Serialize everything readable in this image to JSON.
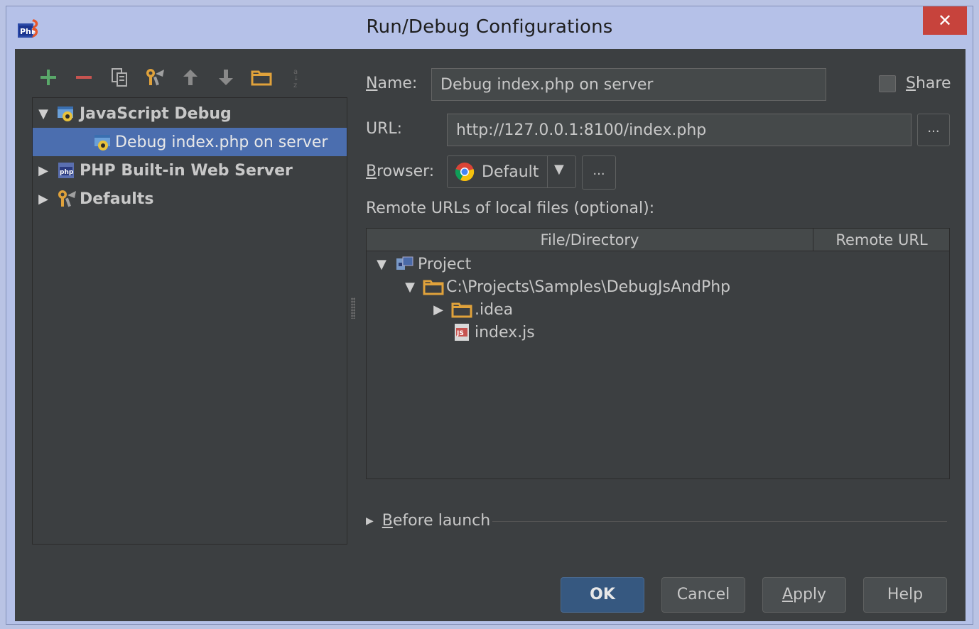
{
  "window": {
    "title": "Run/Debug Configurations",
    "close_label": "✕"
  },
  "tree": {
    "items": [
      {
        "label": "JavaScript Debug",
        "expanded": true
      },
      {
        "label": "Debug index.php on server",
        "selected": true
      },
      {
        "label": "PHP Built-in Web Server",
        "expanded": false
      },
      {
        "label": "Defaults",
        "expanded": false
      }
    ]
  },
  "form": {
    "name_label_u": "N",
    "name_label_rest": "ame:",
    "name_value": "Debug index.php on server",
    "share_label_u": "S",
    "share_label_rest": "hare",
    "url_label": "URL:",
    "url_value": "http://127.0.0.1:8100/index.php",
    "ellipsis": "...",
    "browser_label_u": "B",
    "browser_label_rest": "rowser:",
    "browser_value": "Default",
    "remote_label": "Remote URLs of local files (optional):"
  },
  "mapping_table": {
    "columns": [
      "File/Directory",
      "Remote URL"
    ],
    "rows": [
      {
        "label": "Project"
      },
      {
        "label": "C:\\Projects\\Samples\\DebugJsAndPhp"
      },
      {
        "label": ".idea"
      },
      {
        "label": "index.js"
      }
    ]
  },
  "before_launch": {
    "label_u": "B",
    "label_rest": "efore launch"
  },
  "buttons": {
    "ok": "OK",
    "cancel": "Cancel",
    "apply_u": "A",
    "apply_rest": "pply",
    "help": "Help"
  },
  "colors": {
    "accent_selected": "#4b6eaf",
    "background": "#3c3f41",
    "add_icon": "#59a869",
    "remove_icon": "#c75450"
  }
}
